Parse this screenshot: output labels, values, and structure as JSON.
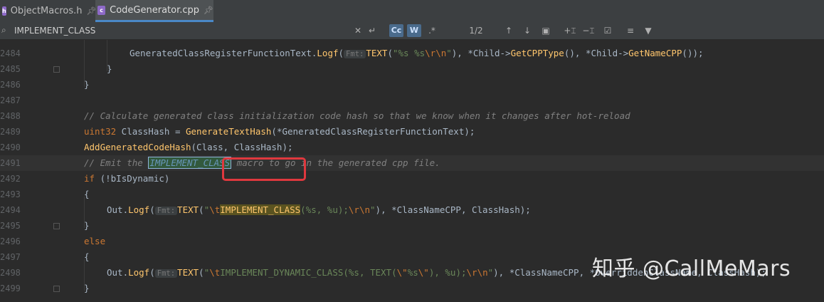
{
  "tabs": [
    {
      "label": "ObjectMacros.h",
      "active": false
    },
    {
      "label": "CodeGenerator.cpp",
      "active": true
    }
  ],
  "find": {
    "query": "IMPLEMENT_CLASS",
    "match_case_label": "Cc",
    "words_label": "W",
    "regex_label": ".*",
    "result_count": "1/2"
  },
  "icons": {
    "tab_file": "cpp-file-icon",
    "pin": "pin-icon",
    "search": "search-icon",
    "clear": "close-icon",
    "history": "undo-icon",
    "prev": "arrow-up-icon",
    "next": "arrow-down-icon",
    "select_all": "select-all-icon",
    "add_occurrence": "add-selection-icon",
    "remove_occurrence": "remove-selection-icon",
    "toggle_select": "toggle-selection-icon",
    "multiline": "multiline-icon",
    "filter": "filter-icon"
  },
  "editor": {
    "lines": [
      {
        "num": "2484"
      },
      {
        "num": "2485"
      },
      {
        "num": "2486"
      },
      {
        "num": "2487"
      },
      {
        "num": "2488"
      },
      {
        "num": "2489"
      },
      {
        "num": "2490"
      },
      {
        "num": "2491"
      },
      {
        "num": "2492"
      },
      {
        "num": "2493"
      },
      {
        "num": "2494"
      },
      {
        "num": "2495"
      },
      {
        "num": "2496"
      },
      {
        "num": "2497"
      },
      {
        "num": "2498"
      },
      {
        "num": "2499"
      }
    ],
    "tokens": {
      "l2484": {
        "p1": "GeneratedClassRegisterFunctionText.",
        "fn1": "Logf",
        "p2": "(",
        "hint": "Fmt:",
        "mac": "TEXT",
        "p3": "(",
        "s1": "\"%s %s",
        "e1": "\\r\\n",
        "s2": "\"",
        "p4": "), *Child->",
        "fn2": "GetCPPType",
        "p5": "(), *Child->",
        "fn3": "GetNameCPP",
        "p6": "());"
      },
      "l2485": {
        "p1": "}"
      },
      "l2486": {
        "p1": "}"
      },
      "l2488": {
        "cm": "// Calculate generated class initialization code hash so that we know when it changes after hot-reload"
      },
      "l2489": {
        "ty": "uint32",
        "p1": " ClassHash = ",
        "fn1": "GenerateTextHash",
        "p2": "(*GeneratedClassRegisterFunctionText);"
      },
      "l2490": {
        "fn1": "AddGeneratedCodeHash",
        "p1": "(Class, ClassHash);"
      },
      "l2491": {
        "cm1": "// Emit the ",
        "hl": "IMPLEMENT_CLASS",
        "cm2": " macro to go in the generated cpp file."
      },
      "l2492": {
        "kw": "if",
        "p1": " (!bIsDynamic)"
      },
      "l2493": {
        "p1": "{"
      },
      "l2494": {
        "p1": "Out.",
        "fn1": "Logf",
        "p2": "(",
        "hint": "Fmt:",
        "mac": "TEXT",
        "p3": "(",
        "s1": "\"",
        "e1": "\\t",
        "hl": "IMPLEMENT_CLASS",
        "s2": "(%s, %u);",
        "e2": "\\r\\n",
        "s3": "\"",
        "p4": "), *ClassNameCPP, ClassHash);"
      },
      "l2495": {
        "p1": "}"
      },
      "l2496": {
        "kw": "else"
      },
      "l2497": {
        "p1": "{"
      },
      "l2498": {
        "p1": "Out.",
        "fn1": "Logf",
        "p2": "(",
        "hint": "Fmt:",
        "mac": "TEXT",
        "p3": "(",
        "s1": "\"",
        "e1": "\\t",
        "s2": "IMPLEMENT_DYNAMIC_CLASS(%s, TEXT(",
        "e2": "\\\"",
        "s3": "%s",
        "e3": "\\\"",
        "s4": "), %u);",
        "e4": "\\r\\n",
        "s5": "\"",
        "p4": "), *ClassNameCPP, *OverriddenClassName, ClassHash);"
      },
      "l2499": {
        "p1": "}"
      }
    }
  },
  "watermark": "知乎 @CallMeMars"
}
